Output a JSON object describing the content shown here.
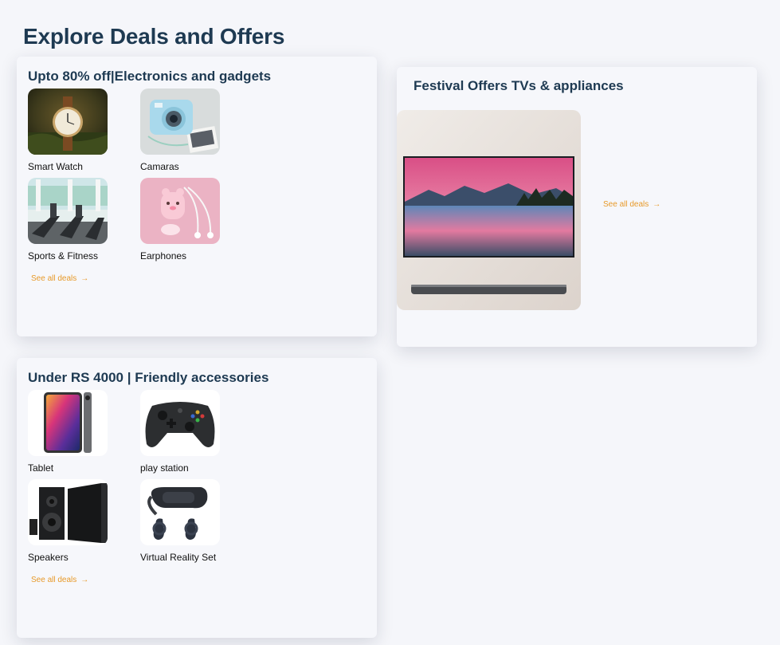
{
  "page": {
    "title": "Explore Deals and Offers"
  },
  "cards": [
    {
      "title": "Upto 80% off|Electronics and gadgets",
      "items": [
        {
          "label": "Smart Watch",
          "image": "watch-image"
        },
        {
          "label": "Camaras",
          "image": "camera-image"
        },
        {
          "label": "Sports & Fitness",
          "image": "treadmill-image"
        },
        {
          "label": "Earphones",
          "image": "earphones-image"
        }
      ],
      "see_all": "See all deals",
      "arrow": "→"
    },
    {
      "title": "Festival Offers TVs & appliances",
      "image": "tv-image",
      "see_all": "See all deals",
      "arrow": "→"
    },
    {
      "title": "Under RS 4000 | Friendly accessories",
      "items": [
        {
          "label": "Tablet",
          "image": "tablet-image"
        },
        {
          "label": "play station",
          "image": "gamepad-image"
        },
        {
          "label": "Speakers",
          "image": "speakers-image"
        },
        {
          "label": "Virtual Reality Set",
          "image": "vr-headset-image"
        }
      ],
      "see_all": "See all deals",
      "arrow": "→"
    }
  ],
  "colors": {
    "background": "#f5f6fa",
    "heading": "#1e3a52",
    "link": "#e79a2a"
  }
}
